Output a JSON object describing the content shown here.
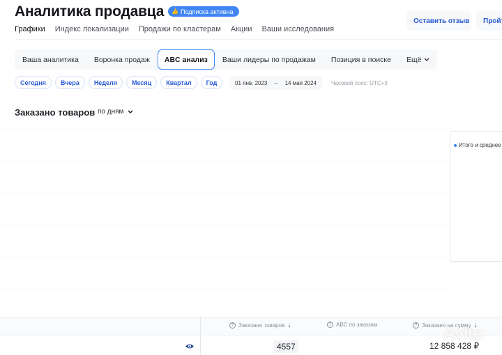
{
  "page": {
    "title": "Аналитика продавца",
    "subscription_badge": "Подписка активна",
    "subscription_icon": "thumbs-up-icon"
  },
  "nav": {
    "tabs": [
      "Графики",
      "Индекс локализации",
      "Продажи по кластерам",
      "Акции",
      "Ваши исследования"
    ]
  },
  "header_buttons": {
    "review": "Оставить отзыв",
    "more": "Пройти"
  },
  "subtabs": {
    "items": [
      "Ваша аналитика",
      "Воронка продаж",
      "ABC анализ",
      "Ваши лидеры по продажам",
      "Позиция в поиске",
      "Ещё"
    ],
    "active": "ABC анализ"
  },
  "periods": [
    "Сегодня",
    "Вчера",
    "Неделя",
    "Месяц",
    "Квартал",
    "Год"
  ],
  "date_range": {
    "from": "01 янв. 2023",
    "separator": "–",
    "to": "14 мая 2024"
  },
  "timezone": "Часовой пояс: UTC+3",
  "section": {
    "title": "Заказано товаров",
    "granularity": "по дням"
  },
  "summary_panel": {
    "legend": "Итого и среднее"
  },
  "table": {
    "columns": [
      {
        "label": "Заказано товаров",
        "sort": "down-arrow-icon"
      },
      {
        "label": "ABC по заказам"
      },
      {
        "label": "Заказано на сумму",
        "sort": "down-arrow-icon"
      }
    ],
    "row": {
      "ordered": "4557",
      "sum": "12 858 428 ₽"
    }
  },
  "watermark": "Avito",
  "colors": {
    "accent": "#3f86f3",
    "link": "#2a5bd7"
  }
}
